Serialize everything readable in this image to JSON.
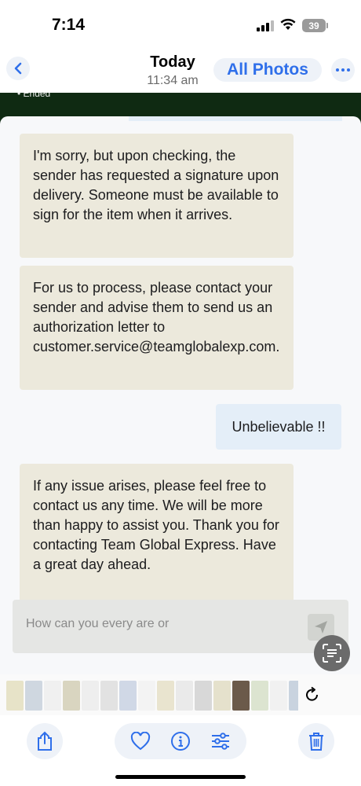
{
  "status_bar": {
    "time": "7:14",
    "battery": "39"
  },
  "header": {
    "title": "Today",
    "subtitle": "11:34 am",
    "all_photos_label": "All Photos"
  },
  "photo": {
    "top_label": "• Ended",
    "messages": [
      {
        "side": "incoming",
        "text": "I'm sorry, but upon checking, the sender has requested a signature upon delivery. Someone must be available to sign for the item when it arrives."
      },
      {
        "side": "incoming",
        "text": "For us to process, please contact your sender and advise them to send us an authorization letter to customer.service@teamglobalexp.com."
      },
      {
        "side": "outgoing",
        "text": "Unbelievable !!"
      },
      {
        "side": "incoming",
        "text": "If any issue arises, please feel free to contact us any time. We will be more than happy to assist you. Thank you for contacting Team Global Express. Have a great day ahead."
      }
    ],
    "input_placeholder": "How can you every are or"
  },
  "thumbnails": [
    "#e7e3c8",
    "#cfd7e0",
    "#f0f0f0",
    "#d9d5c0",
    "#eeeeee",
    "#e2e2e2",
    "#d0d8e6",
    "#f3f3f3",
    "#e9e4cf",
    "#eaeaea",
    "#d8d8d8",
    "#e5e1cc",
    "#6b5a4a",
    "#dce4d0",
    "#f1f1f1",
    "#c9d3df",
    "#3a3a3a"
  ],
  "colors": {
    "accent": "#2f6fea",
    "bubble_in": "#ece9dc",
    "bubble_out": "#e4eef8",
    "photo_bg": "#0f2a12"
  }
}
